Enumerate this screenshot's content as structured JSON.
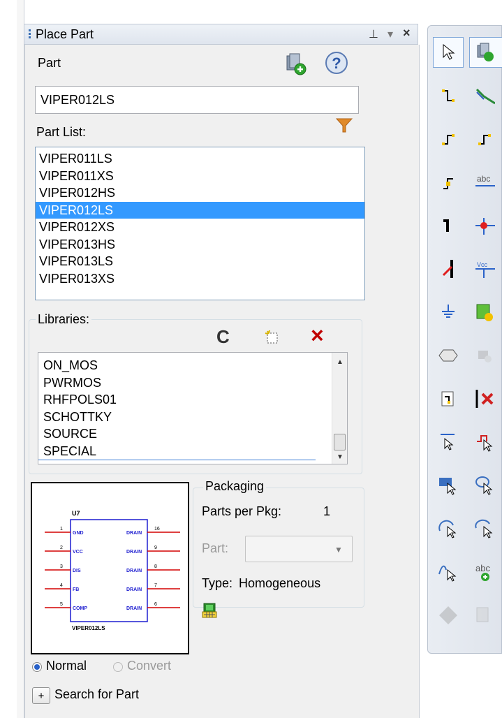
{
  "panel": {
    "title": "Place Part",
    "pin_glyph": "⊥",
    "dropdown_glyph": "▾",
    "close_glyph": "×"
  },
  "part": {
    "label": "Part",
    "value": "VIPER012LS"
  },
  "part_list": {
    "label": "Part List:",
    "items": [
      "VIPER011LS",
      "VIPER011XS",
      "VIPER012HS",
      "VIPER012LS",
      "VIPER012XS",
      "VIPER013HS",
      "VIPER013LS",
      "VIPER013XS"
    ],
    "selected": "VIPER012LS"
  },
  "libraries": {
    "label": "Libraries:",
    "items": [
      "ON_MOS",
      "PWRMOS",
      "RHFPOLS01",
      "SCHOTTKY",
      "SOURCE",
      "SPECIAL"
    ],
    "refresh_glyph": "C",
    "remove_glyph": "×"
  },
  "preview": {
    "ref": "U7",
    "part_name": "VIPER012LS",
    "left_pins": [
      {
        "num": "1",
        "name": "GND"
      },
      {
        "num": "2",
        "name": "VCC"
      },
      {
        "num": "3",
        "name": "DIS"
      },
      {
        "num": "4",
        "name": "FB"
      },
      {
        "num": "5",
        "name": "COMP"
      }
    ],
    "right_pins": [
      {
        "num": "16",
        "name": "DRAIN"
      },
      {
        "num": "9",
        "name": "DRAIN"
      },
      {
        "num": "8",
        "name": "DRAIN"
      },
      {
        "num": "7",
        "name": "DRAIN"
      },
      {
        "num": "6",
        "name": "DRAIN"
      }
    ]
  },
  "packaging": {
    "title": "Packaging",
    "parts_per_pkg_label": "Parts per Pkg:",
    "parts_per_pkg_value": "1",
    "part_label": "Part:",
    "part_value": "",
    "type_label": "Type:",
    "type_value": "Homogeneous"
  },
  "view_mode": {
    "normal_label": "Normal",
    "convert_label": "Convert",
    "selected": "Normal"
  },
  "search": {
    "expand_glyph": "+",
    "label": "Search for Part"
  },
  "colors": {
    "selection": "#3399ff",
    "pin_red": "#d40000",
    "body_blue": "#1f1fd0",
    "filter_orange": "#e08a2a",
    "remove_red": "#c00000"
  }
}
